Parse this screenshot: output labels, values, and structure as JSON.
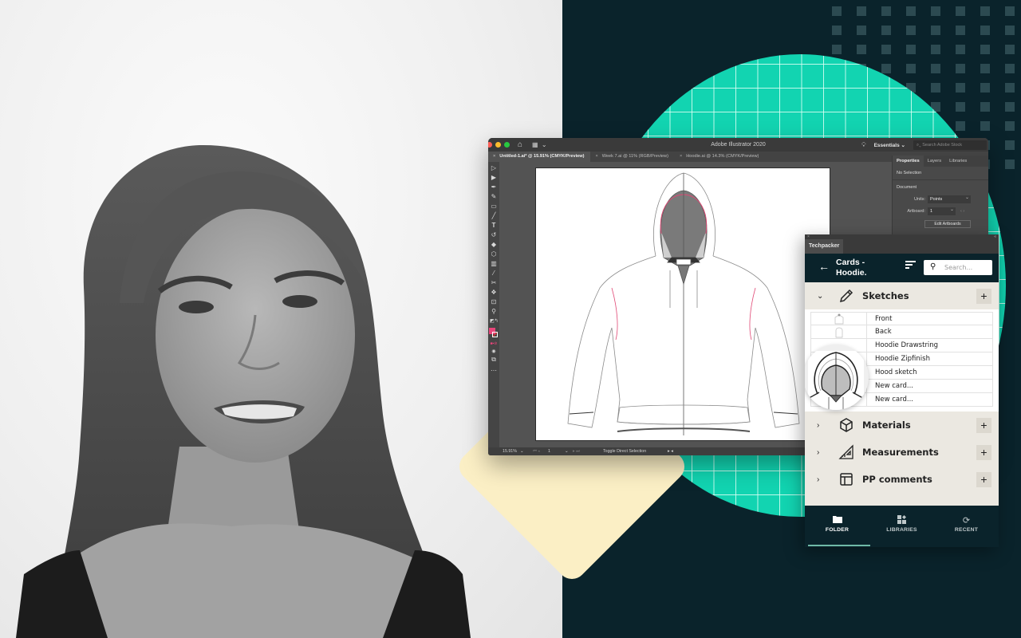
{
  "background": {
    "accent_teal": "#12d4b1",
    "navy": "#0a232b",
    "cream": "#fbefc5"
  },
  "illustrator": {
    "app_title": "Adobe Illustrator 2020",
    "workspace": "Essentials",
    "stock_search_placeholder": "Search Adobe Stock",
    "tabs": [
      {
        "label": "Untitled-1.ai* @ 15.91% (CMYK/Preview)",
        "active": true
      },
      {
        "label": "Week 7.ai @ 11% (RGB/Preview)",
        "active": false
      },
      {
        "label": "Hoodie.ai @ 14.3% (CMYK/Preview)",
        "active": false
      }
    ],
    "properties_panel": {
      "tabs": [
        "Properties",
        "Layers",
        "Libraries"
      ],
      "selection": "No Selection",
      "section": "Document",
      "units_label": "Units:",
      "units_value": "Points",
      "artboard_label": "Artboard:",
      "artboard_value": "1",
      "edit_artboards_label": "Edit Artboards"
    },
    "status_bar": {
      "zoom": "15.91%",
      "artboard_number": "1",
      "tool_hint": "Toggle Direct Selection"
    },
    "fill_color": "#e8457a"
  },
  "techpacker": {
    "panel_tab": "Techpacker",
    "title": "Cards - Hoodie.",
    "search_placeholder": "Search...",
    "sections": [
      {
        "label": "Sketches",
        "icon": "pencil-icon",
        "expanded": true
      },
      {
        "label": "Materials",
        "icon": "cube-icon",
        "expanded": false
      },
      {
        "label": "Measurements",
        "icon": "triangle-ruler-icon",
        "expanded": false
      },
      {
        "label": "PP comments",
        "icon": "layout-icon",
        "expanded": false
      }
    ],
    "sketch_cards": [
      "Front",
      "Back",
      "Hoodie Drawstring",
      "Hoodie Zipfinish",
      "Hood sketch",
      "New card...",
      "New card..."
    ],
    "bottom_nav": [
      {
        "label": "FOLDER",
        "icon": "folder-icon",
        "active": true
      },
      {
        "label": "LIBRARIES",
        "icon": "libraries-icon",
        "active": false
      },
      {
        "label": "RECENT",
        "icon": "refresh-icon",
        "active": false
      }
    ]
  }
}
